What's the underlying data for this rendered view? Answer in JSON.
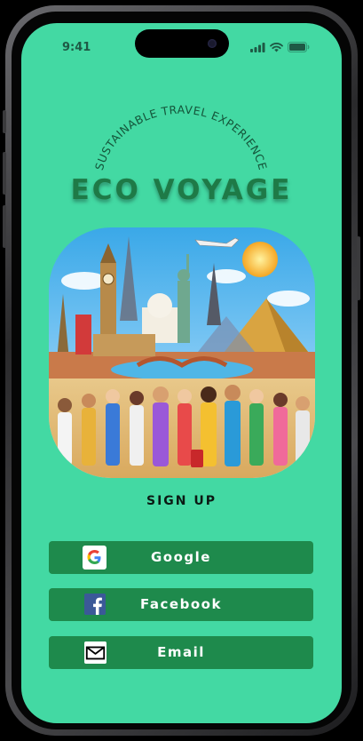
{
  "status_bar": {
    "time": "9:41",
    "icons": [
      "signal-icon",
      "wifi-icon",
      "battery-icon"
    ]
  },
  "header": {
    "tagline": "SUSTAINABLE TRAVEL EXPERIENCE",
    "brand": "ECO VOYAGE"
  },
  "hero": {
    "description_icon": "travel-landmarks-illustration"
  },
  "signup": {
    "label": "SIGN UP",
    "options": [
      {
        "label": "Google",
        "icon": "google-icon"
      },
      {
        "label": "Facebook",
        "icon": "facebook-icon"
      },
      {
        "label": "Email",
        "icon": "email-icon"
      }
    ]
  },
  "colors": {
    "screen_bg": "#43d9a3",
    "brand_text": "#1e7a47",
    "button_bg": "#1e8a4c",
    "button_text": "#ffffff"
  }
}
